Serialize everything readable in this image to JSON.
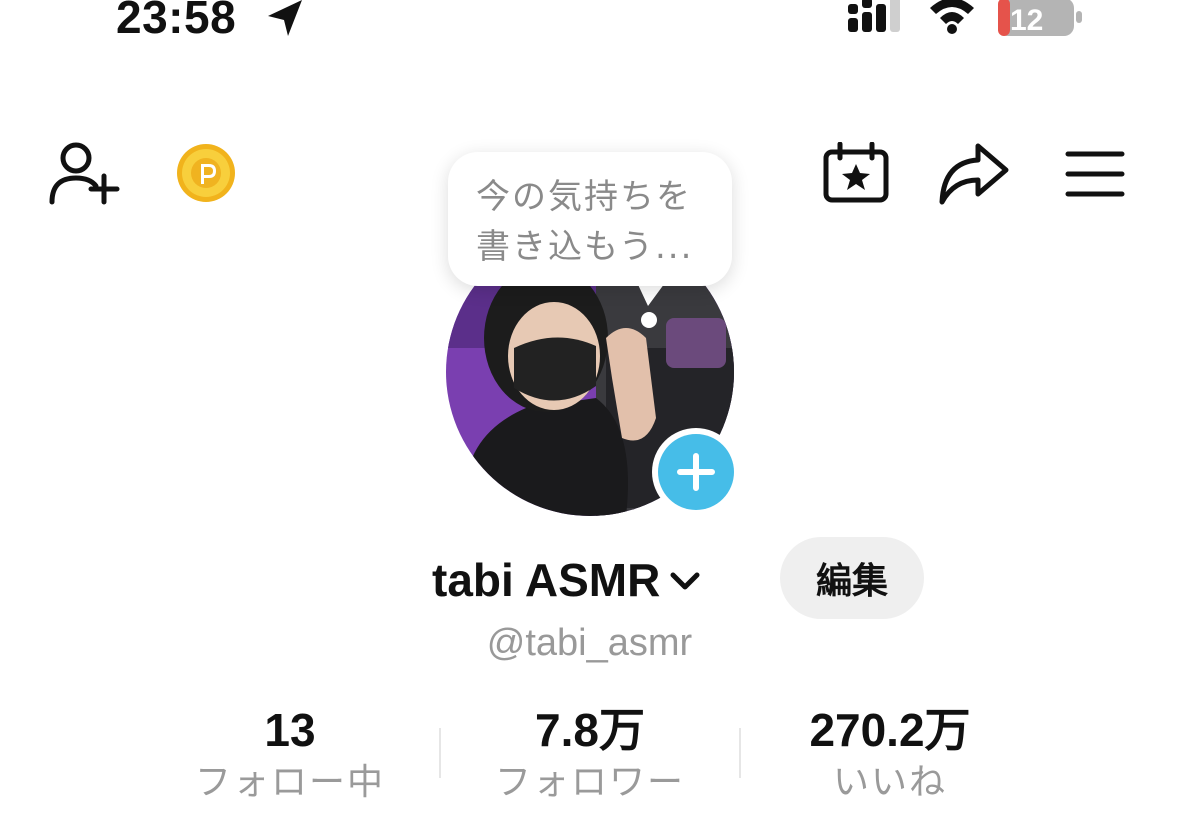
{
  "status_bar": {
    "time": "23:58",
    "battery_level": "12",
    "battery_color": "#e5534b"
  },
  "header": {
    "icons": [
      "add-friend-icon",
      "coin-icon",
      "calendar-star-icon",
      "share-icon",
      "menu-icon"
    ],
    "coin_color": "#f5c518"
  },
  "status_bubble": {
    "line1": "今の気持ちを",
    "line2": "書き込もう..."
  },
  "profile": {
    "display_name": "tabi ASMR",
    "username": "@tabi_asmr",
    "edit_label": "編集",
    "accent_color": "#46bde8"
  },
  "stats": {
    "following_value": "13",
    "following_label": "フォロー中",
    "followers_value": "7.8万",
    "followers_label": "フォロワー",
    "likes_value": "270.2万",
    "likes_label": "いいね"
  }
}
